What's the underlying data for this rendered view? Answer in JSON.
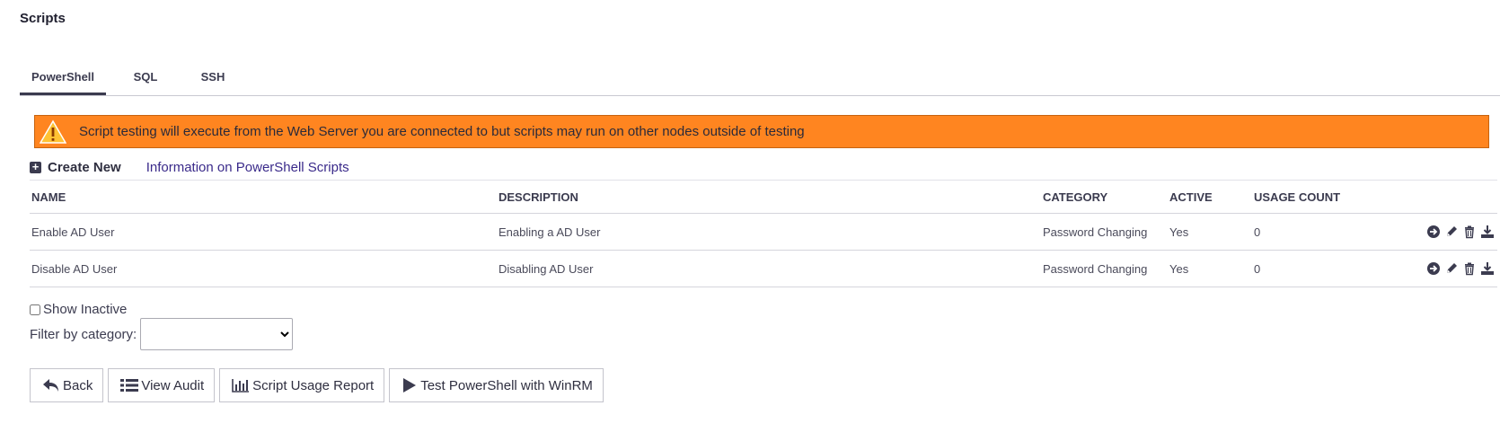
{
  "page": {
    "title": "Scripts"
  },
  "tabs": [
    {
      "label": "PowerShell",
      "active": true
    },
    {
      "label": "SQL",
      "active": false
    },
    {
      "label": "SSH",
      "active": false
    }
  ],
  "alert": {
    "icon": "warning-triangle-icon",
    "message": "Script testing will execute from the Web Server you are connected to but scripts may run on other nodes outside of testing",
    "color": "#ff8520"
  },
  "toolbar": {
    "create_new_label": "Create New",
    "info_link_label": "Information on PowerShell Scripts"
  },
  "table": {
    "columns": [
      "NAME",
      "DESCRIPTION",
      "CATEGORY",
      "ACTIVE",
      "USAGE COUNT"
    ],
    "rows": [
      {
        "name": "Enable AD User",
        "description": "Enabling a AD User",
        "category": "Password Changing",
        "active": "Yes",
        "usage_count": "0"
      },
      {
        "name": "Disable AD User",
        "description": "Disabling AD User",
        "category": "Password Changing",
        "active": "Yes",
        "usage_count": "0"
      }
    ],
    "row_action_icons": [
      "arrow-right-circle-icon",
      "pencil-icon",
      "trash-icon",
      "download-icon"
    ]
  },
  "filters": {
    "show_inactive_label": "Show Inactive",
    "show_inactive_checked": false,
    "category_label": "Filter by category:",
    "category_value": ""
  },
  "buttons": {
    "back": "Back",
    "view_audit": "View Audit",
    "usage_report": "Script Usage Report",
    "test_powershell": "Test PowerShell with WinRM"
  }
}
